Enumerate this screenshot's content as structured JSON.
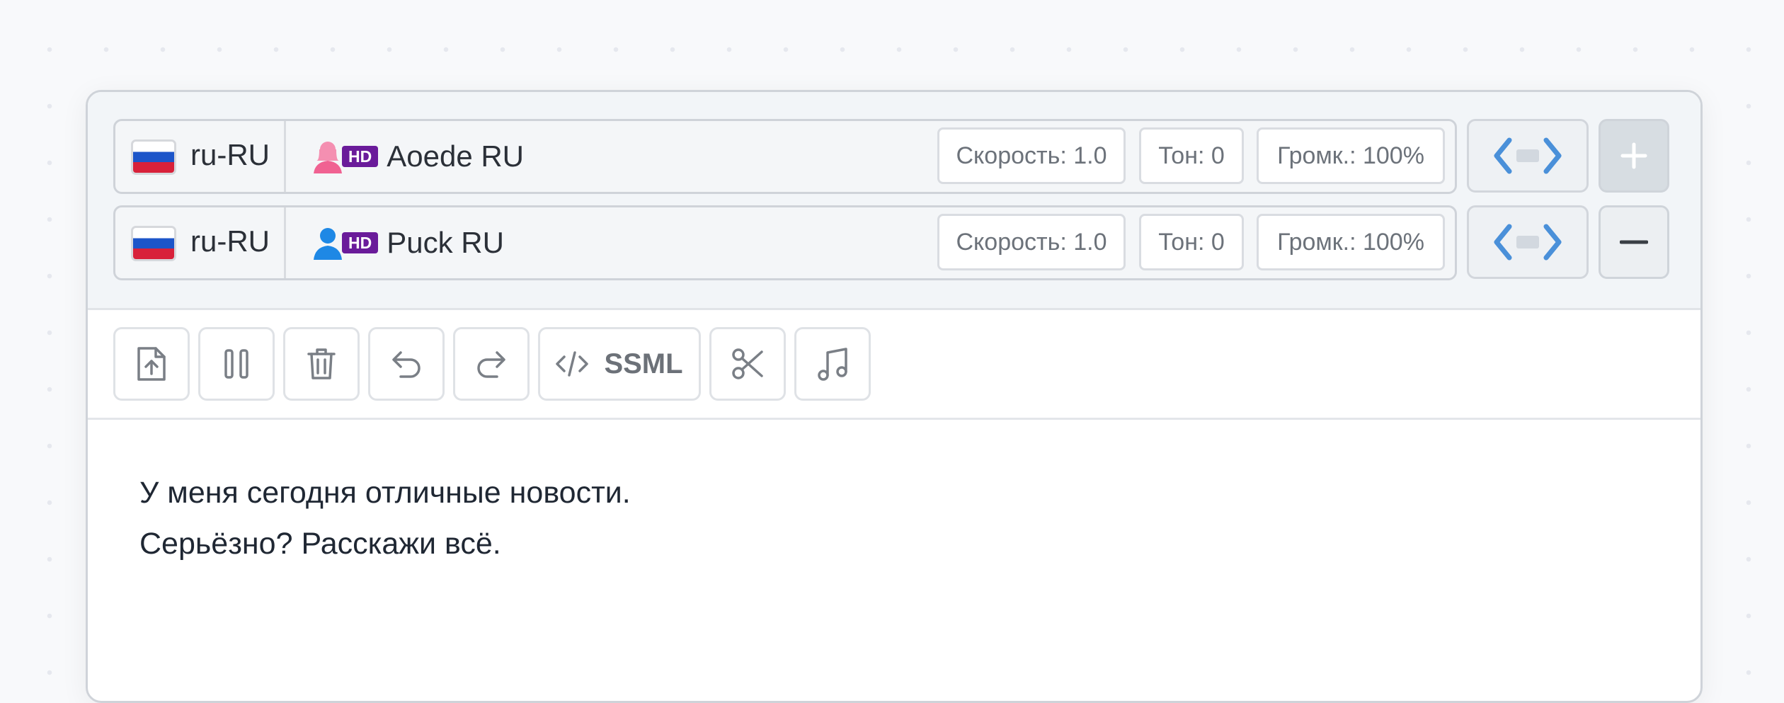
{
  "voices": [
    {
      "lang_code": "ru-RU",
      "flag_icon": "russia-flag-icon",
      "gender_icon": "female-person-icon",
      "gender_color": "#f06292",
      "badge": "HD",
      "name": "Aoede RU",
      "speed": "Скорость: 1.0",
      "tone": "Тон: 0",
      "volume": "Громк.: 100%",
      "action": "+"
    },
    {
      "lang_code": "ru-RU",
      "flag_icon": "russia-flag-icon",
      "gender_icon": "male-person-icon",
      "gender_color": "#1e88e5",
      "badge": "HD",
      "name": "Puck RU",
      "speed": "Скорость: 1.0",
      "tone": "Тон: 0",
      "volume": "Громк.: 100%",
      "action": "−"
    }
  ],
  "toolbar": {
    "buttons": [
      "upload-icon",
      "pause-icon",
      "trash-icon",
      "undo-icon",
      "redo-icon",
      "code-icon",
      "scissors-icon",
      "music-note-icon"
    ],
    "ssml_label": "SSML"
  },
  "editor": {
    "lines": [
      "У меня сегодня отличные новости.",
      "Серьёзно? Расскажи всё."
    ]
  },
  "colors": {
    "accent_blue": "#4a90d9",
    "hd_badge": "#6a1b9a"
  }
}
